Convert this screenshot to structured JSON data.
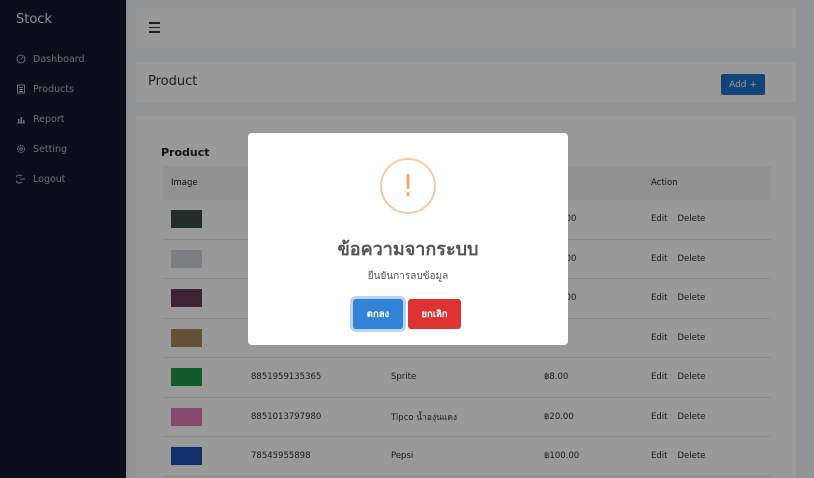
{
  "sidebar": {
    "brand": "Stock",
    "items": [
      {
        "label": "Dashboard",
        "icon": "dashboard-icon"
      },
      {
        "label": "Products",
        "icon": "list-icon"
      },
      {
        "label": "Report",
        "icon": "chart-icon"
      },
      {
        "label": "Setting",
        "icon": "gear-icon"
      },
      {
        "label": "Logout",
        "icon": "logout-icon"
      }
    ]
  },
  "header": {
    "title": "Product",
    "add_label": "Add +"
  },
  "content": {
    "title": "Product",
    "columns": [
      "Image",
      "",
      "",
      "e",
      "Action"
    ],
    "rows": [
      {
        "barcode": "",
        "name": "",
        "price": ",999.00",
        "thumb_color": "#3a4a44"
      },
      {
        "barcode": "",
        "name": "",
        "price": ",000.00",
        "thumb_color": "#cfd3d8"
      },
      {
        "barcode": "",
        "name": "",
        "price": ",000.00",
        "thumb_color": "#6b3a5a"
      },
      {
        "barcode": "",
        "name": "",
        "price": "0.00",
        "thumb_color": "#a8895a"
      },
      {
        "barcode": "8851959135365",
        "name": "Sprite",
        "price": "฿8.00",
        "thumb_color": "#1f9a4a"
      },
      {
        "barcode": "8851013797980",
        "name": "Tipco น้ำองุ่นแดง",
        "price": "฿20.00",
        "thumb_color": "#e07ab0"
      },
      {
        "barcode": "78545955898",
        "name": "Pepsi",
        "price": "฿100.00",
        "thumb_color": "#1f4fb0"
      }
    ],
    "edit_label": "Edit",
    "delete_label": "Delete"
  },
  "modal": {
    "icon": "!",
    "title": "ข้อความจากระบบ",
    "text": "ยืนยันการลบข้อมูล",
    "ok_label": "ตกลง",
    "cancel_label": "ยกเลิก"
  }
}
